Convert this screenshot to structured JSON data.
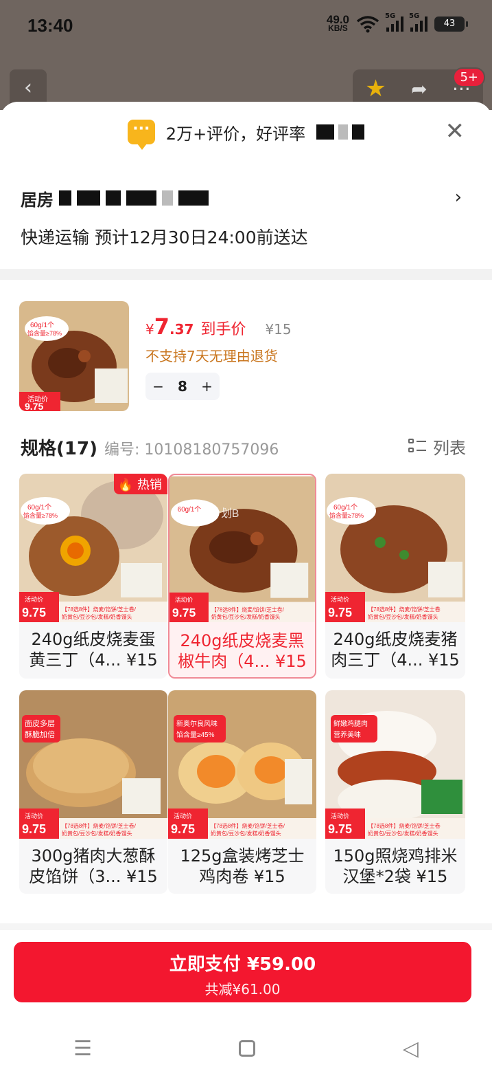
{
  "status_bar": {
    "time": "13:40",
    "net_speed": "49.0",
    "net_unit": "KB/S",
    "sig1_label": "5G",
    "sig2_label": "5G",
    "battery": "43"
  },
  "top_actions": {
    "badge": "5+"
  },
  "sheet": {
    "review_text": "2万+评价，好评率",
    "address_visible_prefix": "居房",
    "shipping_text": "快递运输 预计12月30日24:00前送达"
  },
  "product": {
    "price_symbol": "¥",
    "price_int": "7",
    "price_dec": ".37",
    "price_label": "到手价",
    "price_original": "¥15",
    "return_policy": "不支持7天无理由退货",
    "quantity": "8",
    "minus": "−",
    "plus": "+"
  },
  "specs": {
    "title": "规格(17)",
    "code": "编号: 10108180757096",
    "list_label": "列表",
    "hot_label": "热销",
    "items": [
      {
        "name": "240g纸皮烧麦蛋黄三丁（4... ¥15"
      },
      {
        "name": "240g纸皮烧麦黑椒牛肉（4... ¥15"
      },
      {
        "name": "240g纸皮烧麦猪肉三丁（4... ¥15"
      },
      {
        "name": "300g猪肉大葱酥皮馅饼（3... ¥15"
      },
      {
        "name": "125g盒装烤芝士鸡肉卷 ¥15"
      },
      {
        "name": "150g照烧鸡排米汉堡*2袋 ¥15"
      }
    ],
    "img_labels": {
      "activity": "活动价",
      "price": "9.75",
      "weight_tag": "60g/1个",
      "fill_tag": "馅含量≥78%",
      "promo": "【78选8件】烧麦/馅饼/芝士卷/奶黄包/豆沙包/发糕/奶香馒头",
      "tag4a": "面皮多层",
      "tag4b": "酥脆加倍",
      "tag5a": "新奥尔良风味",
      "tag5b": "馅含量≥45%",
      "tag6a": "鲜嫩鸡腿肉",
      "tag6b": "营养美味",
      "overlay": "B计划B"
    }
  },
  "pay": {
    "main": "立即支付 ¥59.00",
    "sub": "共减¥61.00"
  },
  "nav": {
    "menu": "☰",
    "back": "◁"
  },
  "colors": {
    "accent": "#f3172f",
    "price_red": "#ef2531",
    "warn_orange": "#c9761f"
  }
}
